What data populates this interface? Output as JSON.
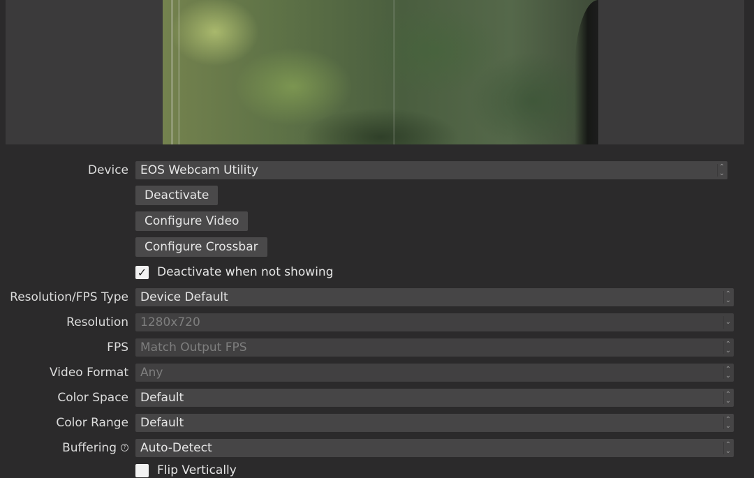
{
  "preview": {},
  "device": {
    "label": "Device",
    "value": "EOS Webcam Utility",
    "deactivate_label": "Deactivate",
    "configure_video_label": "Configure Video",
    "configure_crossbar_label": "Configure Crossbar",
    "deactivate_when_not_showing_label": "Deactivate when not showing",
    "deactivate_when_not_showing_checked": true
  },
  "resolution_fps_type": {
    "label": "Resolution/FPS Type",
    "value": "Device Default"
  },
  "resolution": {
    "label": "Resolution",
    "value": "1280x720",
    "disabled": true
  },
  "fps": {
    "label": "FPS",
    "value": "Match Output FPS",
    "disabled": true
  },
  "video_format": {
    "label": "Video Format",
    "value": "Any",
    "disabled": true
  },
  "color_space": {
    "label": "Color Space",
    "value": "Default"
  },
  "color_range": {
    "label": "Color Range",
    "value": "Default"
  },
  "buffering": {
    "label": "Buffering",
    "value": "Auto-Detect"
  },
  "flip_vertically": {
    "label": "Flip Vertically",
    "checked": false
  },
  "icons": {
    "checkmark": "✓",
    "spin_updown": "⌃⌄",
    "chevron_down": "⌄",
    "help": "?"
  }
}
